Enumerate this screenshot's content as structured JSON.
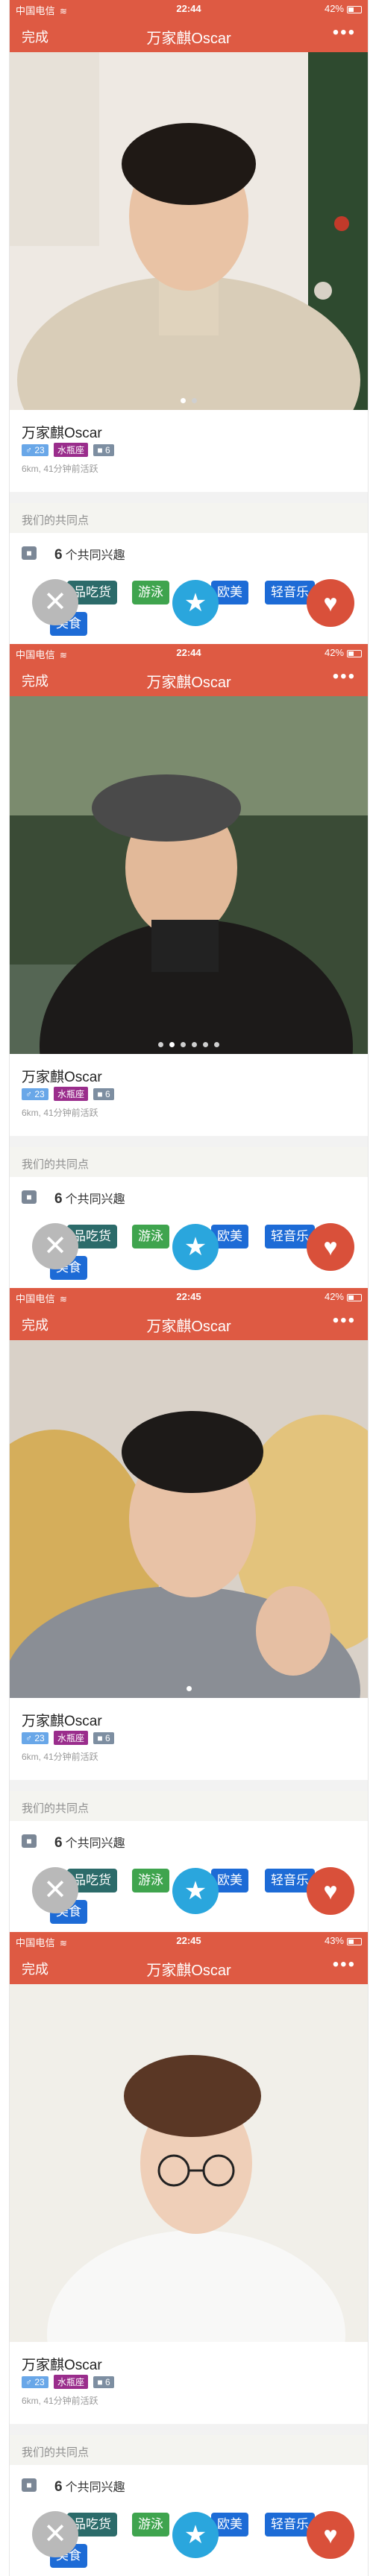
{
  "screens": [
    {
      "status": {
        "carrier": "中国电信",
        "time": "22:44",
        "battery": "42%"
      },
      "nav": {
        "done": "完成",
        "title": "万家麒Oscar",
        "more": "•••"
      },
      "profile": {
        "name": "万家麒Oscar",
        "age": "♂ 23",
        "zodiac": "水瓶座",
        "work": "6",
        "meta": "6km, 41分钟前活跃"
      },
      "section": "我们的共同点",
      "common": {
        "count": "6",
        "label": "个共同兴趣"
      },
      "interests": [
        "品吃货",
        "游泳",
        "欧美",
        "轻音乐",
        "美食"
      ]
    },
    {
      "status": {
        "carrier": "中国电信",
        "time": "22:44",
        "battery": "42%"
      },
      "nav": {
        "done": "完成",
        "title": "万家麒Oscar",
        "more": "•••"
      },
      "profile": {
        "name": "万家麒Oscar",
        "age": "♂ 23",
        "zodiac": "水瓶座",
        "work": "6",
        "meta": "6km, 41分钟前活跃"
      },
      "section": "我们的共同点",
      "common": {
        "count": "6",
        "label": "个共同兴趣"
      },
      "interests": [
        "品吃货",
        "游泳",
        "欧美",
        "轻音乐",
        "美食"
      ]
    },
    {
      "status": {
        "carrier": "中国电信",
        "time": "22:45",
        "battery": "42%"
      },
      "nav": {
        "done": "完成",
        "title": "万家麒Oscar",
        "more": "•••"
      },
      "profile": {
        "name": "万家麒Oscar",
        "age": "♂ 23",
        "zodiac": "水瓶座",
        "work": "6",
        "meta": "6km, 41分钟前活跃"
      },
      "section": "我们的共同点",
      "common": {
        "count": "6",
        "label": "个共同兴趣"
      },
      "interests": [
        "品吃货",
        "游泳",
        "欧美",
        "轻音乐",
        "美食"
      ]
    },
    {
      "status": {
        "carrier": "中国电信",
        "time": "22:45",
        "battery": "43%"
      },
      "nav": {
        "done": "完成",
        "title": "万家麒Oscar",
        "more": "•••"
      },
      "profile": {
        "name": "万家麒Oscar",
        "age": "♂ 23",
        "zodiac": "水瓶座",
        "work": "6",
        "meta": "6km, 41分钟前活跃"
      },
      "section": "我们的共同点",
      "common": {
        "count": "6",
        "label": "个共同兴趣"
      },
      "interests": [
        "品吃货",
        "游泳",
        "欧美",
        "轻音乐",
        "美食"
      ]
    }
  ],
  "colors": {
    "header": "#de5a43",
    "heart": "#d9503a",
    "star": "#2aa6dd",
    "dislike": "#b9b9b9"
  },
  "icons": [
    "wifi-icon",
    "battery-icon",
    "more-icon",
    "briefcase-icon",
    "close-icon",
    "star-icon",
    "heart-icon"
  ]
}
